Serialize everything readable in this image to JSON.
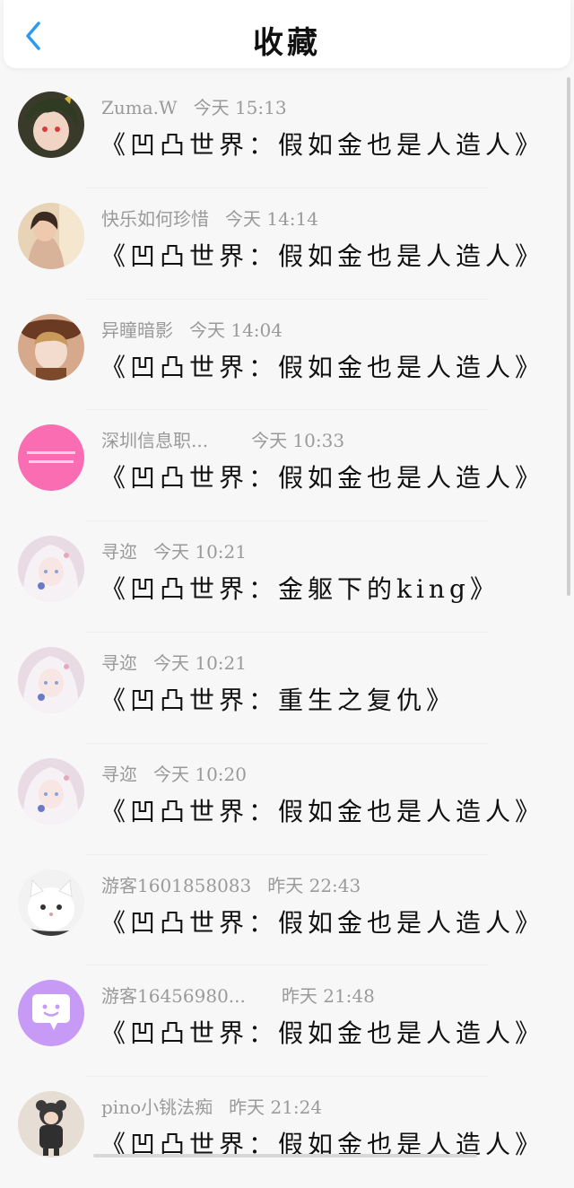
{
  "header": {
    "title": "收藏",
    "back_icon": "chevron-left-icon",
    "accent_color": "#2a9bf0"
  },
  "items": [
    {
      "user": "Zuma.W",
      "time": "今天 15:13",
      "content": "《凹凸世界：假如金也是人造人》",
      "avatar": "anime-dark-hair-red-eyes"
    },
    {
      "user": "快乐如何珍惜",
      "time": "今天 14:14",
      "content": "《凹凸世界：假如金也是人造人》",
      "avatar": "girl-photo"
    },
    {
      "user": "异瞳暗影",
      "time": "今天 14:04",
      "content": "《凹凸世界：假如金也是人造人》",
      "avatar": "anime-hat-character"
    },
    {
      "user": "深圳信息职...",
      "time": "今天 10:33",
      "content": "《凹凸世界：假如金也是人造人》",
      "avatar": "pink-text-avatar"
    },
    {
      "user": "寻迩",
      "time": "今天 10:21",
      "content": "《凹凸世界：金躯下的king》",
      "avatar": "anime-white-hair-girl"
    },
    {
      "user": "寻迩",
      "time": "今天 10:21",
      "content": "《凹凸世界：重生之复仇》",
      "avatar": "anime-white-hair-girl"
    },
    {
      "user": "寻迩",
      "time": "今天 10:20",
      "content": "《凹凸世界：假如金也是人造人》",
      "avatar": "anime-white-hair-girl"
    },
    {
      "user": "游客1601858083",
      "time": "昨天 22:43",
      "content": "《凹凸世界：假如金也是人造人》",
      "avatar": "white-cat"
    },
    {
      "user": "游客16456980...",
      "time": "昨天 21:48",
      "content": "《凹凸世界：假如金也是人造人》",
      "avatar": "purple-chat-bubble"
    },
    {
      "user": "pino小铫法痴",
      "time": "昨天 21:24",
      "content": "《凹凸世界：假如金也是人造人》",
      "avatar": "child-bear-hat"
    }
  ]
}
